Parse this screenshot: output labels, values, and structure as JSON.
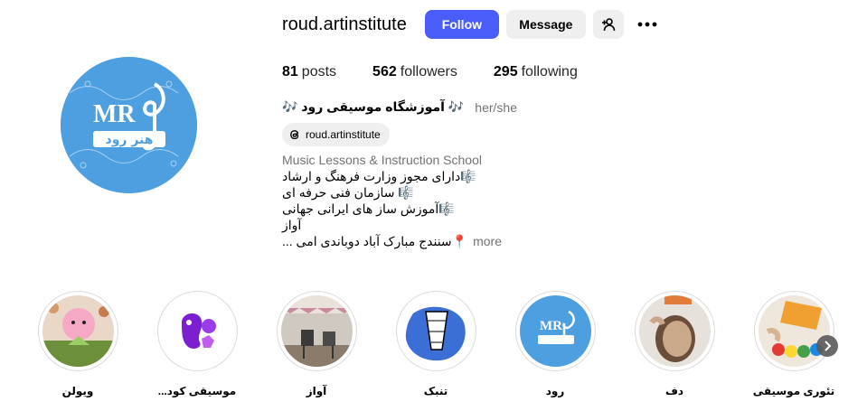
{
  "profile": {
    "username": "roud.artinstitute",
    "follow_label": "Follow",
    "message_label": "Message",
    "avatar_icon": "profile-logo-avatar",
    "stats": {
      "posts_count": "81",
      "posts_label": "posts",
      "followers_count": "562",
      "followers_label": "followers",
      "following_count": "295",
      "following_label": "following"
    },
    "full_name": "🎶 آموزشگاه موسیقی رود 🎶",
    "pronouns": "her/she",
    "threads_handle": "roud.artinstitute",
    "bio": {
      "category": "Music Lessons & Instruction School",
      "line1": "🎼دارای مجوز وزارت فرهنگ و ارشاد",
      "line2": "🎼 سازمان فنی حرفه ای",
      "line3": "🎼آموزش ساز های ایرانی جهانی",
      "line4": "آواز",
      "line5": "📍سنندج مبارک آباد دوباندی امی ...",
      "more_label": "more"
    }
  },
  "highlights": [
    {
      "label": "ویولن"
    },
    {
      "label": "موسیقی کود..."
    },
    {
      "label": "آواز"
    },
    {
      "label": "تنبک"
    },
    {
      "label": "رود"
    },
    {
      "label": "دف"
    },
    {
      "label": "تئوری موسیقی"
    }
  ],
  "colors": {
    "follow_button": "#4a5df9",
    "secondary_button": "#efefef",
    "avatar_bg": "#4d9fe0",
    "muted_text": "#737373"
  }
}
